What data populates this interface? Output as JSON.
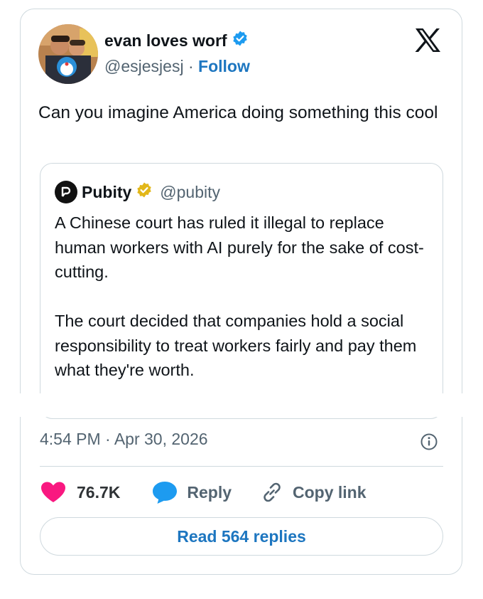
{
  "tweet": {
    "author": {
      "name": "evan loves worf",
      "handle": "@esjesjesj",
      "separator": "·",
      "follow_label": "Follow"
    },
    "text": "Can you imagine America doing something this cool",
    "quoted": {
      "name": "Pubity",
      "handle": "@pubity",
      "paragraphs": [
        "A Chinese court has ruled it illegal to replace human workers with AI purely for the sake of cost-cutting.",
        "The court decided that companies hold a social responsibility to treat workers fairly and pay them what they're worth."
      ]
    },
    "timestamp": "4:54 PM · Apr 30, 2026",
    "actions": {
      "likes": "76.7K",
      "reply_label": "Reply",
      "copy_label": "Copy link"
    },
    "read_replies_label": "Read 564 replies"
  },
  "icons": [
    "avatar-image",
    "verified-badge-icon",
    "x-logo-icon",
    "pubity-logo-icon",
    "gold-verified-icon",
    "info-icon",
    "heart-icon",
    "reply-bubble-icon",
    "link-icon"
  ],
  "colors": {
    "link_blue": "#1d76c0",
    "verified_blue": "#1d9bf0",
    "verified_gold": "#e2b719",
    "heart": "#f91880",
    "text": "#0f1419",
    "secondary": "#536471",
    "border": "#cfd9de"
  }
}
